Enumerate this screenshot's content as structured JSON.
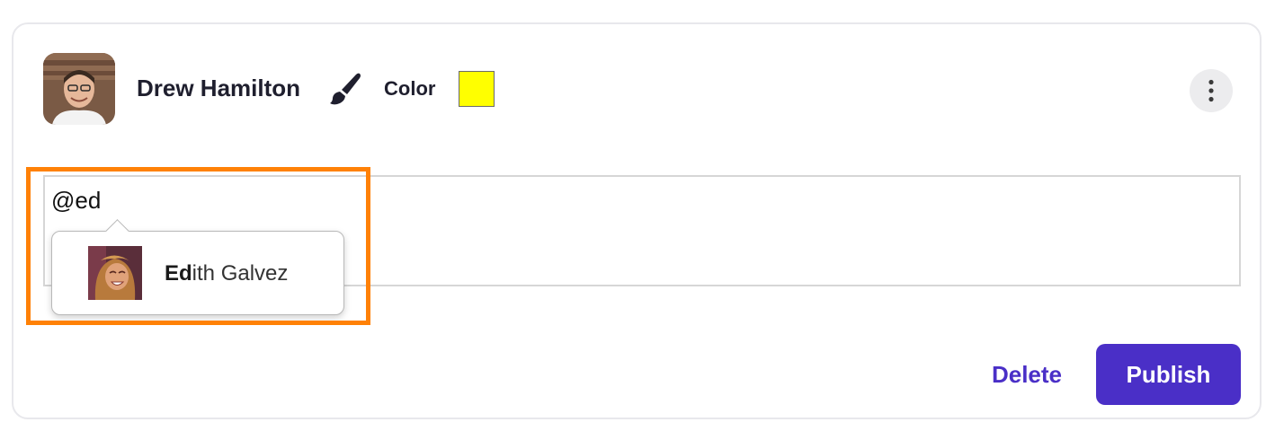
{
  "author": {
    "name": "Drew Hamilton",
    "avatar_icon": "user-photo"
  },
  "toolbar": {
    "brush_icon": "paint-brush-icon",
    "color_label": "Color",
    "color_value": "#ffff00",
    "more_icon": "vertical-ellipsis-icon"
  },
  "editor": {
    "text": "@ed"
  },
  "mention_popup": {
    "suggestions": [
      {
        "name_match": "Ed",
        "name_rest": "ith Galvez",
        "avatar_icon": "user-photo"
      }
    ]
  },
  "actions": {
    "delete_label": "Delete",
    "publish_label": "Publish"
  },
  "colors": {
    "accent": "#4a2fc7",
    "highlight": "#ff8106",
    "swatch": "#ffff00"
  }
}
